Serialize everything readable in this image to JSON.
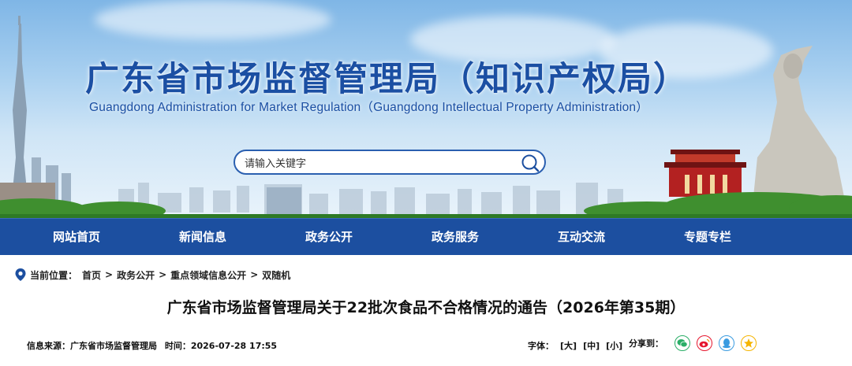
{
  "header": {
    "title": "广东省市场监督管理局（知识产权局）",
    "subtitle": "Guangdong Administration for Market Regulation（Guangdong Intellectual Property Administration）"
  },
  "search": {
    "placeholder": "请输入关键字"
  },
  "nav": {
    "items": [
      {
        "label": "网站首页"
      },
      {
        "label": "新闻信息"
      },
      {
        "label": "政务公开"
      },
      {
        "label": "政务服务"
      },
      {
        "label": "互动交流"
      },
      {
        "label": "专题专栏"
      }
    ]
  },
  "breadcrumb": {
    "prefix": "当前位置：",
    "items": [
      "首页",
      "政务公开",
      "重点领域信息公开",
      "双随机"
    ],
    "separator": ">"
  },
  "article": {
    "title": "广东省市场监督管理局关于22批次食品不合格情况的通告（2026年第35期）",
    "source_label": "信息来源：",
    "source": "广东省市场监督管理局",
    "time_label": "时间：",
    "time": "2026-07-28 17:55"
  },
  "tools": {
    "font_label": "字体：",
    "font_options": [
      "[大]",
      "[中]",
      "[小]"
    ],
    "share_label": "分享到：",
    "share_icons": [
      "wechat-icon",
      "weibo-icon",
      "qq-icon",
      "qzone-icon"
    ]
  },
  "colors": {
    "nav_bg": "#1c4fa0",
    "title_blue": "#1b4fa3",
    "wechat": "#2aae67",
    "weibo": "#e6162d",
    "qq": "#3a9be0",
    "qzone": "#f5b400"
  }
}
